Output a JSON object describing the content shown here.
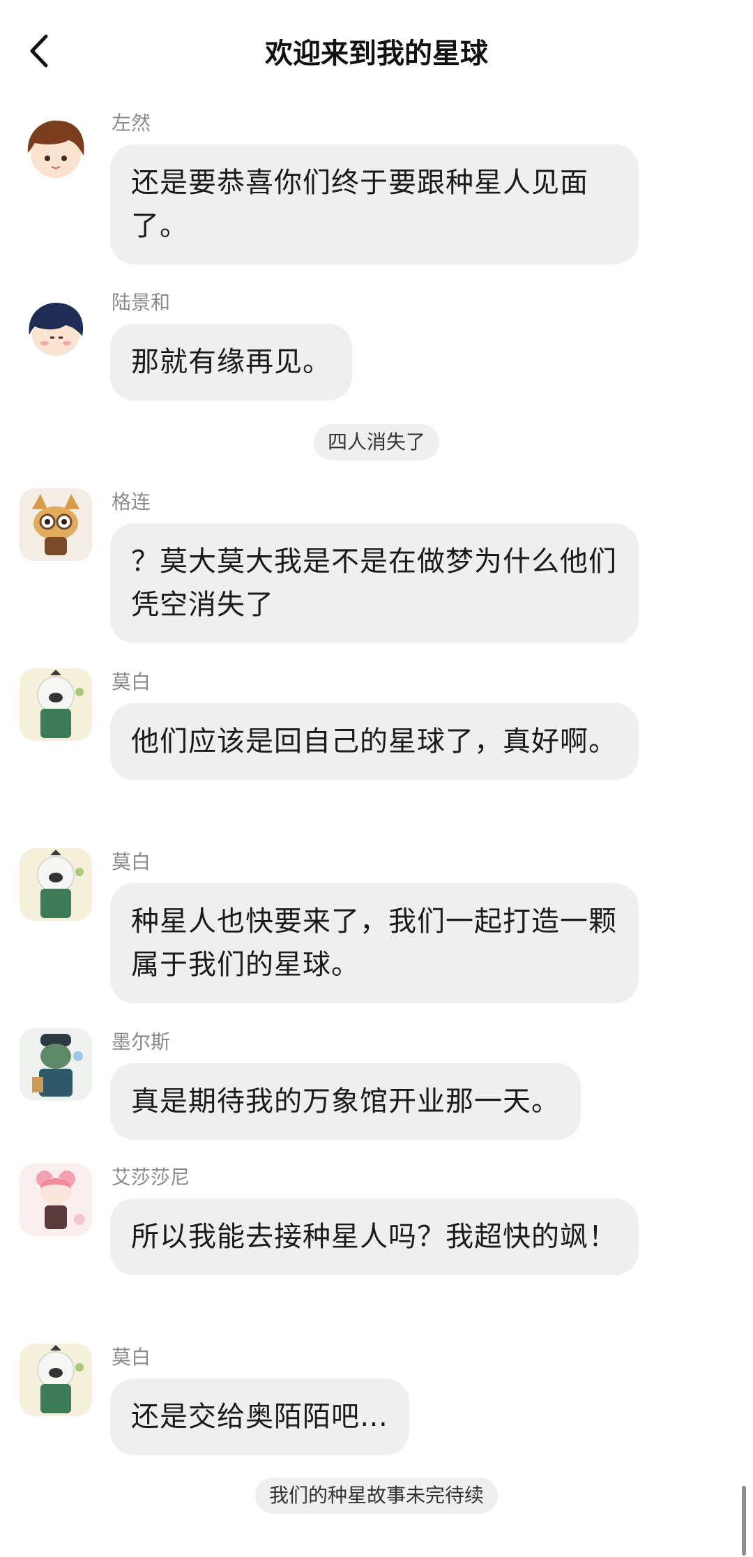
{
  "header": {
    "title": "欢迎来到我的星球",
    "back_icon": "chevron-left-icon"
  },
  "messages": [
    {
      "sender": "左然",
      "text": "还是要恭喜你们终于要跟种星人见面了。",
      "avatar": "boy-brown-hair-avatar"
    },
    {
      "sender": "陆景和",
      "text": "那就有缘再见。",
      "avatar": "boy-navy-hair-avatar"
    },
    {
      "sender": "格连",
      "text": "？莫大莫大我是不是在做梦为什么他们凭空消失了",
      "avatar": "tan-cat-avatar"
    },
    {
      "sender": "莫白",
      "text": "他们应该是回自己的星球了，真好啊。",
      "avatar": "white-lion-avatar"
    },
    {
      "sender": "莫白",
      "text": "种星人也快要来了，我们一起打造一颗属于我们的星球。",
      "avatar": "white-lion-avatar"
    },
    {
      "sender": "墨尔斯",
      "text": "真是期待我的万象馆开业那一天。",
      "avatar": "green-reptile-avatar"
    },
    {
      "sender": "艾莎莎尼",
      "text": "所以我能去接种星人吗？我超快的飒！",
      "avatar": "pink-girl-avatar"
    },
    {
      "sender": "莫白",
      "text": "还是交给奥陌陌吧…",
      "avatar": "white-lion-avatar"
    }
  ],
  "system_notices": {
    "vanished": "四人消失了",
    "ending": "我们的种星故事未完待续"
  },
  "colors": {
    "bubble": "#efefef",
    "sender_name": "#8a8a8a",
    "text": "#1a1a1a"
  }
}
